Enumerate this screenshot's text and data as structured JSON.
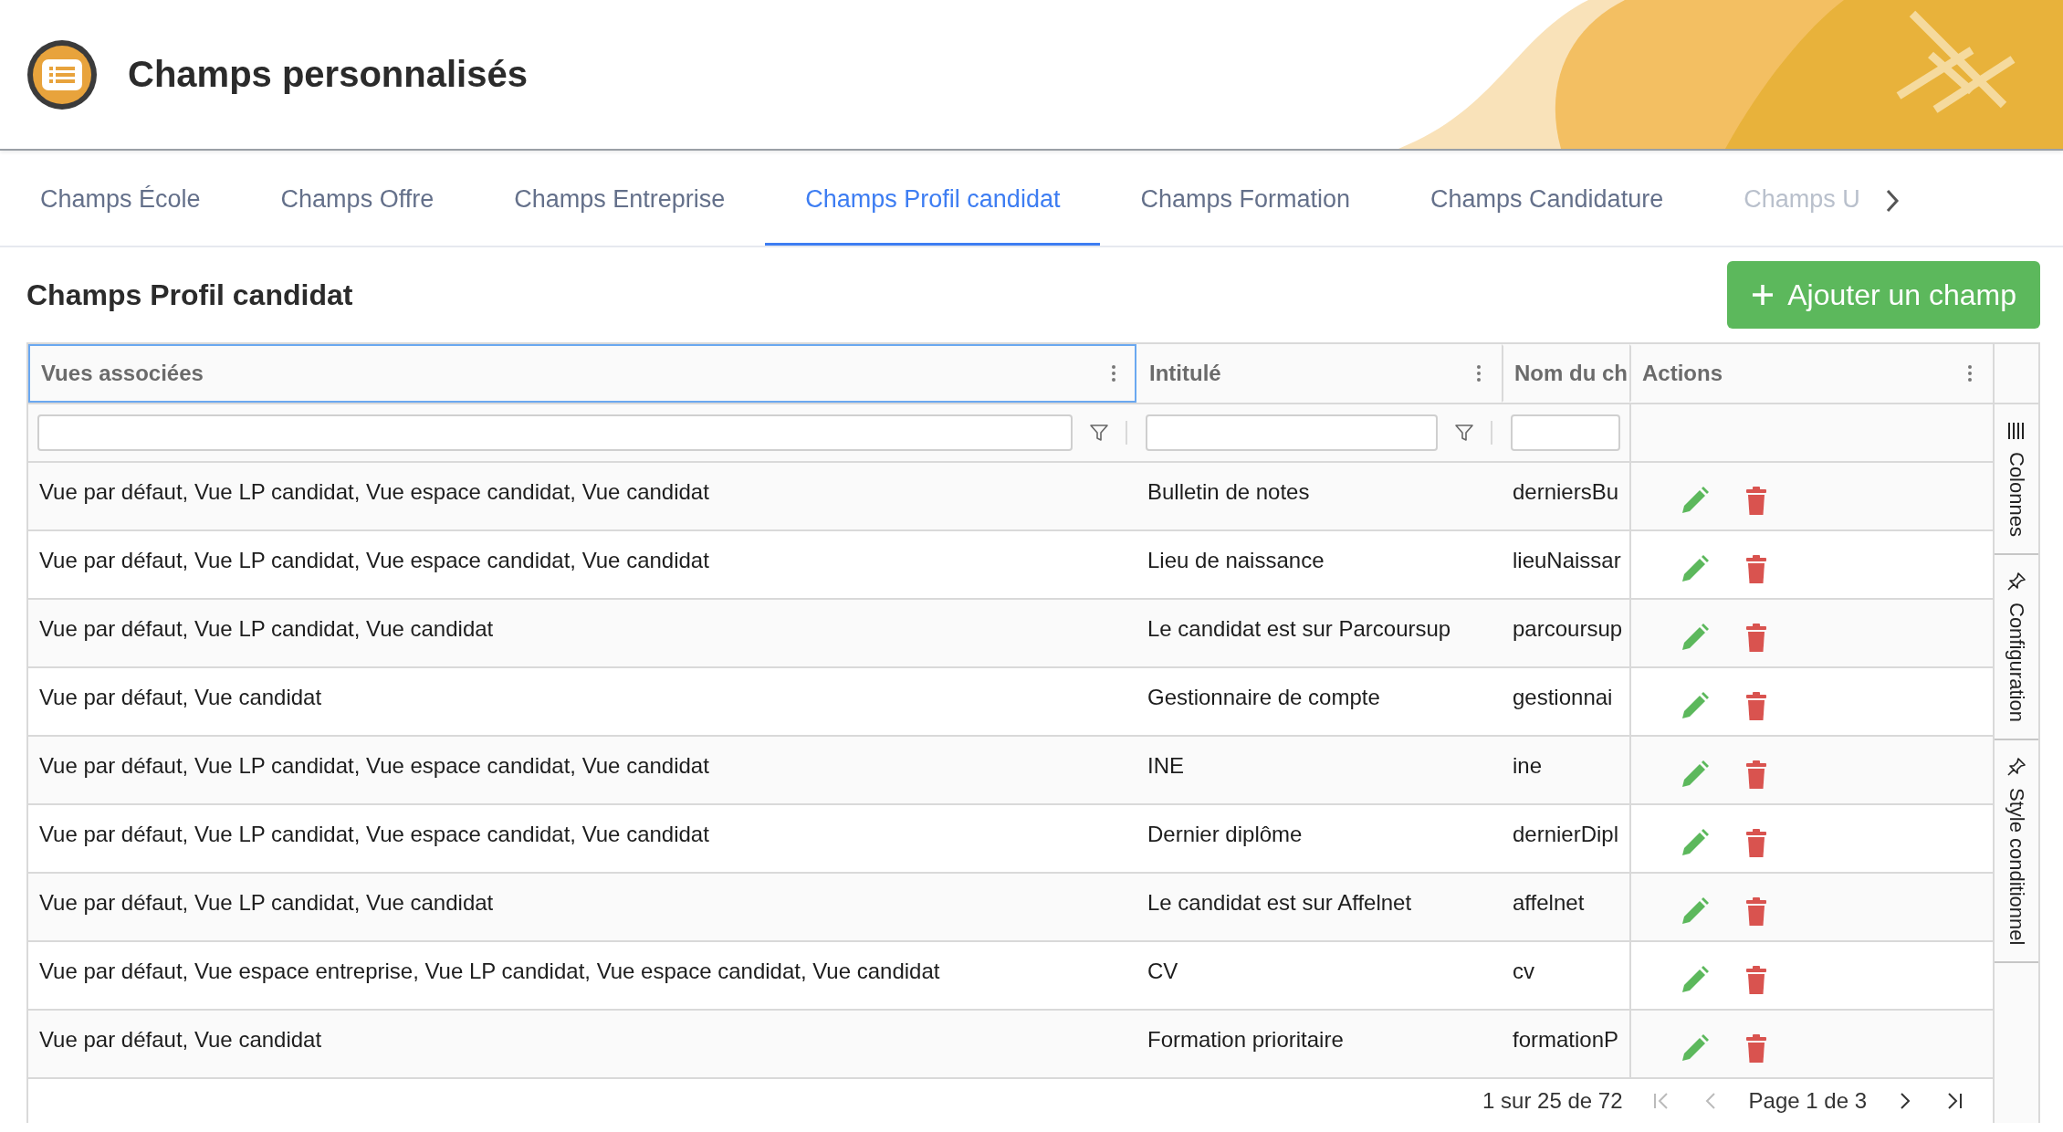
{
  "header": {
    "title": "Champs personnalisés"
  },
  "tabs": [
    {
      "label": "Champs École",
      "selected": false
    },
    {
      "label": "Champs Offre",
      "selected": false
    },
    {
      "label": "Champs Entreprise",
      "selected": false
    },
    {
      "label": "Champs Profil candidat",
      "selected": true
    },
    {
      "label": "Champs Formation",
      "selected": false
    },
    {
      "label": "Champs Candidature",
      "selected": false
    },
    {
      "label": "Champs U",
      "selected": false
    }
  ],
  "section": {
    "title": "Champs Profil candidat",
    "add_button": "Ajouter un champ"
  },
  "table": {
    "columns": [
      {
        "label": "Vues associées",
        "focused": true,
        "filter": true
      },
      {
        "label": "Intitulé",
        "focused": false,
        "filter": true
      },
      {
        "label": "Nom du ch",
        "focused": false,
        "filter": false
      },
      {
        "label": "Actions",
        "focused": false,
        "filter": false
      }
    ],
    "rows": [
      {
        "views": "Vue par défaut, Vue LP candidat, Vue espace candidat, Vue candidat",
        "label": "Bulletin de notes",
        "name": "derniersBu"
      },
      {
        "views": "Vue par défaut, Vue LP candidat, Vue espace candidat, Vue candidat",
        "label": "Lieu de naissance",
        "name": "lieuNaissar"
      },
      {
        "views": "Vue par défaut, Vue LP candidat, Vue candidat",
        "label": "Le candidat est sur Parcoursup",
        "name": "parcoursup"
      },
      {
        "views": "Vue par défaut, Vue candidat",
        "label": "Gestionnaire de compte",
        "name": "gestionnai"
      },
      {
        "views": "Vue par défaut, Vue LP candidat, Vue espace candidat, Vue candidat",
        "label": "INE",
        "name": "ine"
      },
      {
        "views": "Vue par défaut, Vue LP candidat, Vue espace candidat, Vue candidat",
        "label": "Dernier diplôme",
        "name": "dernierDipl"
      },
      {
        "views": "Vue par défaut, Vue LP candidat, Vue candidat",
        "label": "Le candidat est sur Affelnet",
        "name": "affelnet"
      },
      {
        "views": "Vue par défaut, Vue espace entreprise, Vue LP candidat, Vue espace candidat, Vue candidat",
        "label": "CV",
        "name": "cv"
      },
      {
        "views": "Vue par défaut, Vue candidat",
        "label": "Formation prioritaire",
        "name": "formationP"
      }
    ],
    "pagination": {
      "summary": "1 sur 25 de 72",
      "page": "Page 1 de 3"
    }
  },
  "side_tabs": [
    {
      "label": "Colonnes",
      "kind": "columns"
    },
    {
      "label": "Configuration",
      "kind": "pin"
    },
    {
      "label": "Style conditionnel",
      "kind": "pin"
    }
  ]
}
